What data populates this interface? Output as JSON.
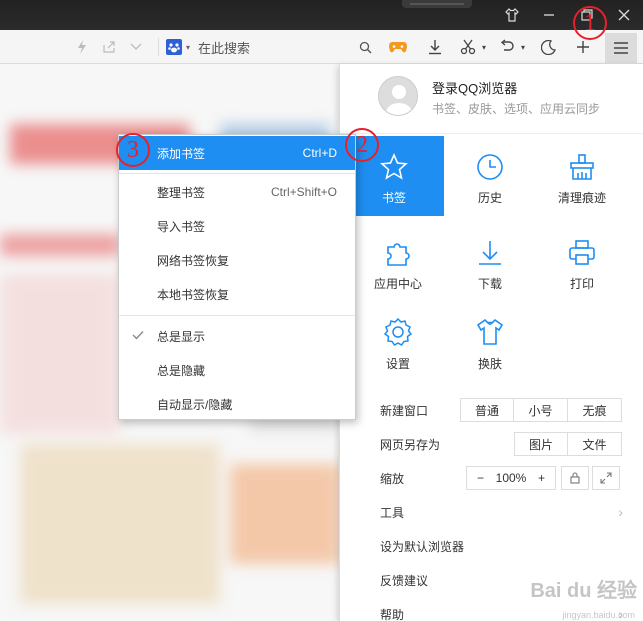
{
  "address_bar": {
    "search_placeholder": "在此搜索"
  },
  "account": {
    "title": "登录QQ浏览器",
    "subtitle": "书签、皮肤、选项、应用云同步"
  },
  "grid": [
    {
      "label": "书签",
      "icon": "star-icon",
      "active": true
    },
    {
      "label": "历史",
      "icon": "clock-icon"
    },
    {
      "label": "清理痕迹",
      "icon": "broom-icon"
    },
    {
      "label": "应用中心",
      "icon": "puzzle-icon"
    },
    {
      "label": "下载",
      "icon": "download-icon"
    },
    {
      "label": "打印",
      "icon": "printer-icon"
    },
    {
      "label": "设置",
      "icon": "gear-icon"
    },
    {
      "label": "换肤",
      "icon": "shirt-icon"
    }
  ],
  "new_window": {
    "label": "新建窗口",
    "options": [
      "普通",
      "小号",
      "无痕"
    ]
  },
  "save_as": {
    "label": "网页另存为",
    "options": [
      "图片",
      "文件"
    ]
  },
  "zoom": {
    "label": "缩放",
    "minus": "−",
    "value": "100%",
    "plus": "+"
  },
  "panel_items": [
    "工具",
    "设为默认浏览器",
    "反馈建议",
    "帮助"
  ],
  "bookmark_menu": {
    "items": [
      {
        "label": "添加书签",
        "shortcut": "Ctrl+D",
        "active": true
      },
      {
        "label": "整理书签",
        "shortcut": "Ctrl+Shift+O"
      },
      {
        "label": "导入书签",
        "shortcut": ""
      },
      {
        "label": "网络书签恢复",
        "shortcut": ""
      },
      {
        "label": "本地书签恢复",
        "shortcut": ""
      },
      {
        "label": "总是显示",
        "shortcut": "",
        "checked": true
      },
      {
        "label": "总是隐藏",
        "shortcut": ""
      },
      {
        "label": "自动显示/隐藏",
        "shortcut": ""
      }
    ]
  },
  "annotations": [
    "1",
    "2",
    "3"
  ],
  "watermark": {
    "brand": "Bai du 经验",
    "url": "jingyan.baidu.com"
  },
  "colors": {
    "accent": "#1e8ef2",
    "annotation": "#e8202a",
    "titlebar": "#222222"
  }
}
